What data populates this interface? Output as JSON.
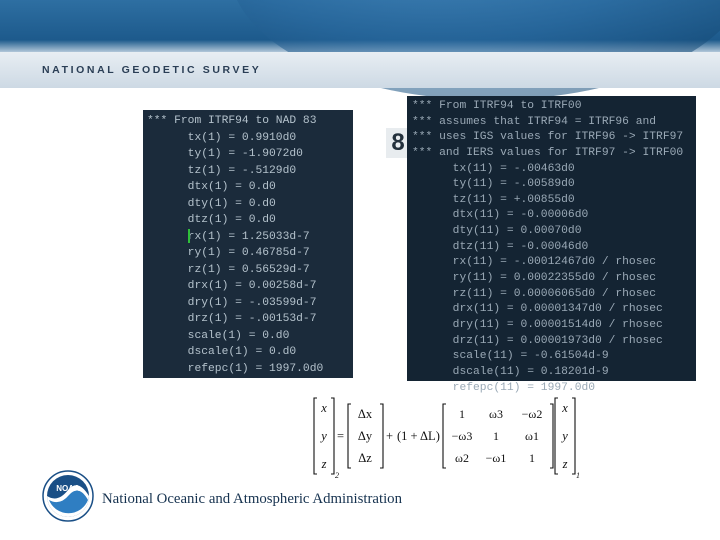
{
  "header": {
    "agency": "NATIONAL GEODETIC SURVEY"
  },
  "left_panel": {
    "lines": [
      "*** From ITRF94 to NAD 83",
      "      tx(1) = 0.9910d0",
      "      ty(1) = -1.9072d0",
      "      tz(1) = -.5129d0",
      "      dtx(1) = 0.d0",
      "      dty(1) = 0.d0",
      "      dtz(1) = 0.d0",
      "      rx(1) = 1.25033d-7",
      "      ry(1) = 0.46785d-7",
      "      rz(1) = 0.56529d-7",
      "      drx(1) = 0.00258d-7",
      "      dry(1) = -.03599d-7",
      "      drz(1) = -.00153d-7",
      "      scale(1) = 0.d0",
      "      dscale(1) = 0.d0",
      "      refepc(1) = 1997.0d0"
    ]
  },
  "right_panel": {
    "lines": [
      "*** From ITRF94 to ITRF00",
      "*** assumes that ITRF94 = ITRF96 and",
      "*** uses IGS values for ITRF96 -> ITRF97",
      "*** and IERS values for ITRF97 -> ITRF00",
      "      tx(11) = -.00463d0",
      "      ty(11) = -.00589d0",
      "      tz(11) = +.00855d0",
      "      dtx(11) = -0.00006d0",
      "      dty(11) = 0.00070d0",
      "      dtz(11) = -0.00046d0",
      "      rx(11) = -.00012467d0 / rhosec",
      "      ry(11) = 0.00022355d0 / rhosec",
      "      rz(11) = 0.00006065d0 / rhosec",
      "      drx(11) = 0.00001347d0 / rhosec",
      "      dry(11) = 0.00001514d0 / rhosec",
      "      drz(11) = 0.00001973d0 / rhosec",
      "      scale(11) = -0.61504d-9",
      "      dscale(11) = 0.18201d-9",
      "      refepc(11) = 1997.0d0"
    ]
  },
  "slide_fragment": "8",
  "equation": {
    "lhs_vec": [
      "x",
      "y",
      "z"
    ],
    "lhs_sub": "2",
    "eq_sign": "=",
    "delta_vec": [
      "Δx",
      "Δy",
      "Δz"
    ],
    "plus_sign": "+",
    "scale_factor": "(1 + ΔL)",
    "rot_matrix": [
      [
        "1",
        "ω3",
        "−ω2"
      ],
      [
        "−ω3",
        "1",
        "ω1"
      ],
      [
        "ω2",
        "−ω1",
        "1"
      ]
    ],
    "rhs_vec": [
      "x",
      "y",
      "z"
    ],
    "rhs_sub": "1"
  },
  "logo": {
    "text": "NOAA"
  },
  "footer": {
    "org_name": "National Oceanic and Atmospheric Administration"
  },
  "colors": {
    "header_blue": "#1d5a8c",
    "panel_bg": "#1b2b3b",
    "code_text": "#b4c2cc",
    "footer_text": "#16324f"
  }
}
